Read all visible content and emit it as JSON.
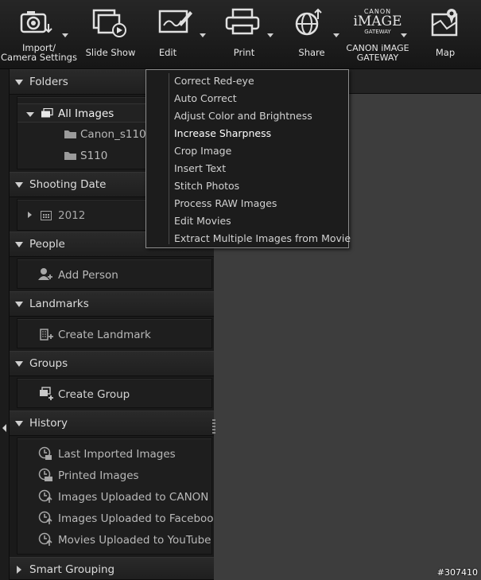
{
  "toolbar": {
    "import": {
      "line1": "Import/",
      "line2": "Camera Settings",
      "icon": "camera-import-icon"
    },
    "slideshow": {
      "label": "Slide Show",
      "icon": "slideshow-icon"
    },
    "edit": {
      "label": "Edit",
      "icon": "edit-icon"
    },
    "print": {
      "label": "Print",
      "icon": "printer-icon"
    },
    "share": {
      "label": "Share",
      "icon": "share-globe-icon"
    },
    "gateway": {
      "logo_line1": "CANON",
      "logo_line2": "iMAGE",
      "logo_line3": "GATEWAY",
      "line1": "CANON iMAGE",
      "line2": "GATEWAY"
    },
    "map": {
      "label": "Map",
      "icon": "map-icon"
    }
  },
  "sidebar": {
    "folders": {
      "title": "Folders",
      "all_images": "All Images",
      "items": [
        "Canon_s110",
        "S110"
      ]
    },
    "shooting_date": {
      "title": "Shooting Date",
      "year": "2012"
    },
    "people": {
      "title": "People",
      "action": "Add Person"
    },
    "landmarks": {
      "title": "Landmarks",
      "action": "Create Landmark"
    },
    "groups": {
      "title": "Groups",
      "action": "Create Group"
    },
    "history": {
      "title": "History",
      "items": [
        "Last Imported Images",
        "Printed Images",
        "Images Uploaded to CANON",
        "Images Uploaded to Faceboo",
        "Movies Uploaded to YouTube"
      ]
    },
    "smart_grouping": {
      "title": "Smart Grouping"
    }
  },
  "edit_menu": {
    "items": [
      "Correct Red-eye",
      "Auto Correct",
      "Adjust Color and Brightness",
      "Increase Sharpness",
      "Crop Image",
      "Insert Text",
      "Stitch Photos",
      "Process RAW Images",
      "Edit Movies",
      "Extract Multiple Images from Movie"
    ],
    "highlighted": "Increase Sharpness"
  },
  "watermark": "#307410"
}
